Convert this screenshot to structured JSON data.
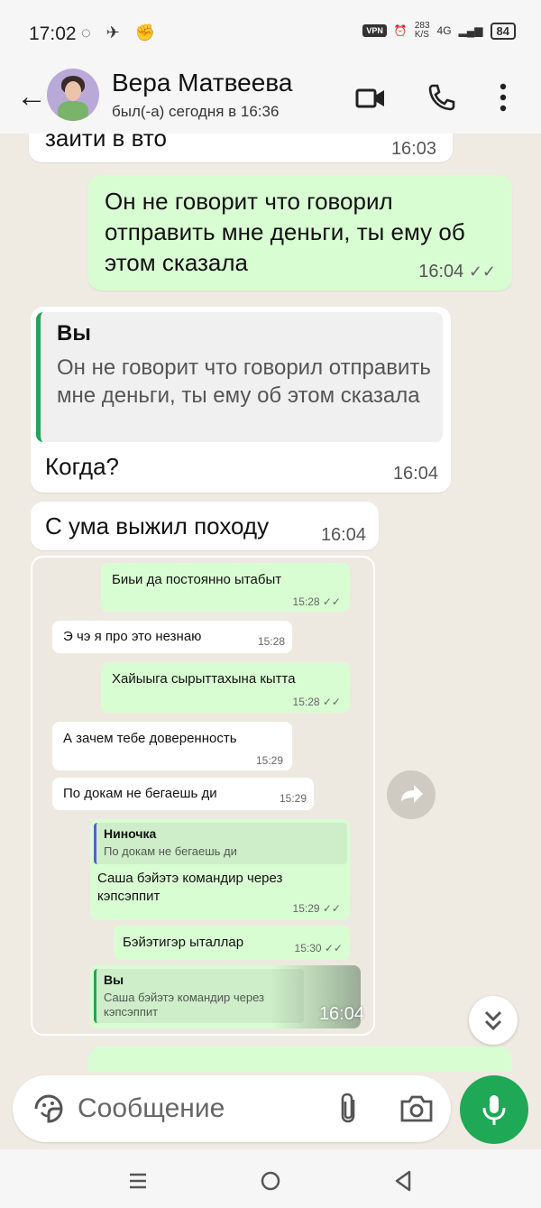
{
  "status_bar": {
    "time": "17:02",
    "vpn": "VPN",
    "speed": "283",
    "speed_unit": "K/S",
    "network": "4G",
    "battery": "84"
  },
  "header": {
    "contact_name": "Вера Матвеева",
    "last_seen": "был(-а) сегодня в 16:36"
  },
  "messages": [
    {
      "direction": "in",
      "text": "зайти в вто",
      "time": "16:03"
    },
    {
      "direction": "out",
      "text": "Он не говорит что говорил отправить мне деньги, ты ему об этом сказала",
      "time": "16:04",
      "ticks": "✓✓"
    },
    {
      "direction": "in",
      "quote_author": "Вы",
      "quote_text": "Он не говорит что говорил отправить мне деньги, ты ему об этом сказала",
      "text": "Когда?",
      "time": "16:04"
    },
    {
      "direction": "in",
      "text": "С ума выжил походу",
      "time": "16:04"
    }
  ],
  "image_message": {
    "time": "16:04",
    "inner": [
      {
        "direction": "out",
        "text": "Биьи да постоянно ытабыт",
        "time": "15:28 ✓✓"
      },
      {
        "direction": "in",
        "text": "Э чэ я про это незнаю",
        "time": "15:28"
      },
      {
        "direction": "out",
        "text": "Хайыыга сырыттахына кытта",
        "time": "15:28 ✓✓"
      },
      {
        "direction": "in",
        "text": "А зачем тебе доверенность",
        "time": "15:29"
      },
      {
        "direction": "in",
        "text": "По докам не бегаешь ди",
        "time": "15:29"
      },
      {
        "direction": "out",
        "quote_author": "Ниночка",
        "quote_text": "По докам не бегаешь ди",
        "text": "Саша бэйэтэ командир через кэпсэппит",
        "time": "15:29 ✓✓"
      },
      {
        "direction": "out",
        "text": "Бэйэтигэр ыталлар",
        "time": "15:30 ✓✓"
      },
      {
        "direction": "out",
        "quote_author": "Вы",
        "quote_text": "Саша бэйэтэ командир через кэпсэппит",
        "text": "",
        "time": ""
      }
    ]
  },
  "input": {
    "placeholder": "Сообщение"
  },
  "icons": {
    "back": "arrow-left-icon",
    "video": "video-call-icon",
    "call": "phone-icon",
    "more": "more-vertical-icon",
    "emoji": "sticker-icon",
    "attach": "paperclip-icon",
    "camera": "camera-icon",
    "mic": "mic-icon",
    "forward": "forward-icon",
    "scroll": "chevron-double-down-icon"
  },
  "colors": {
    "accent": "#1fa855",
    "outgoing": "#d9fdd3",
    "incoming": "#ffffff",
    "background": "#efeae2"
  }
}
